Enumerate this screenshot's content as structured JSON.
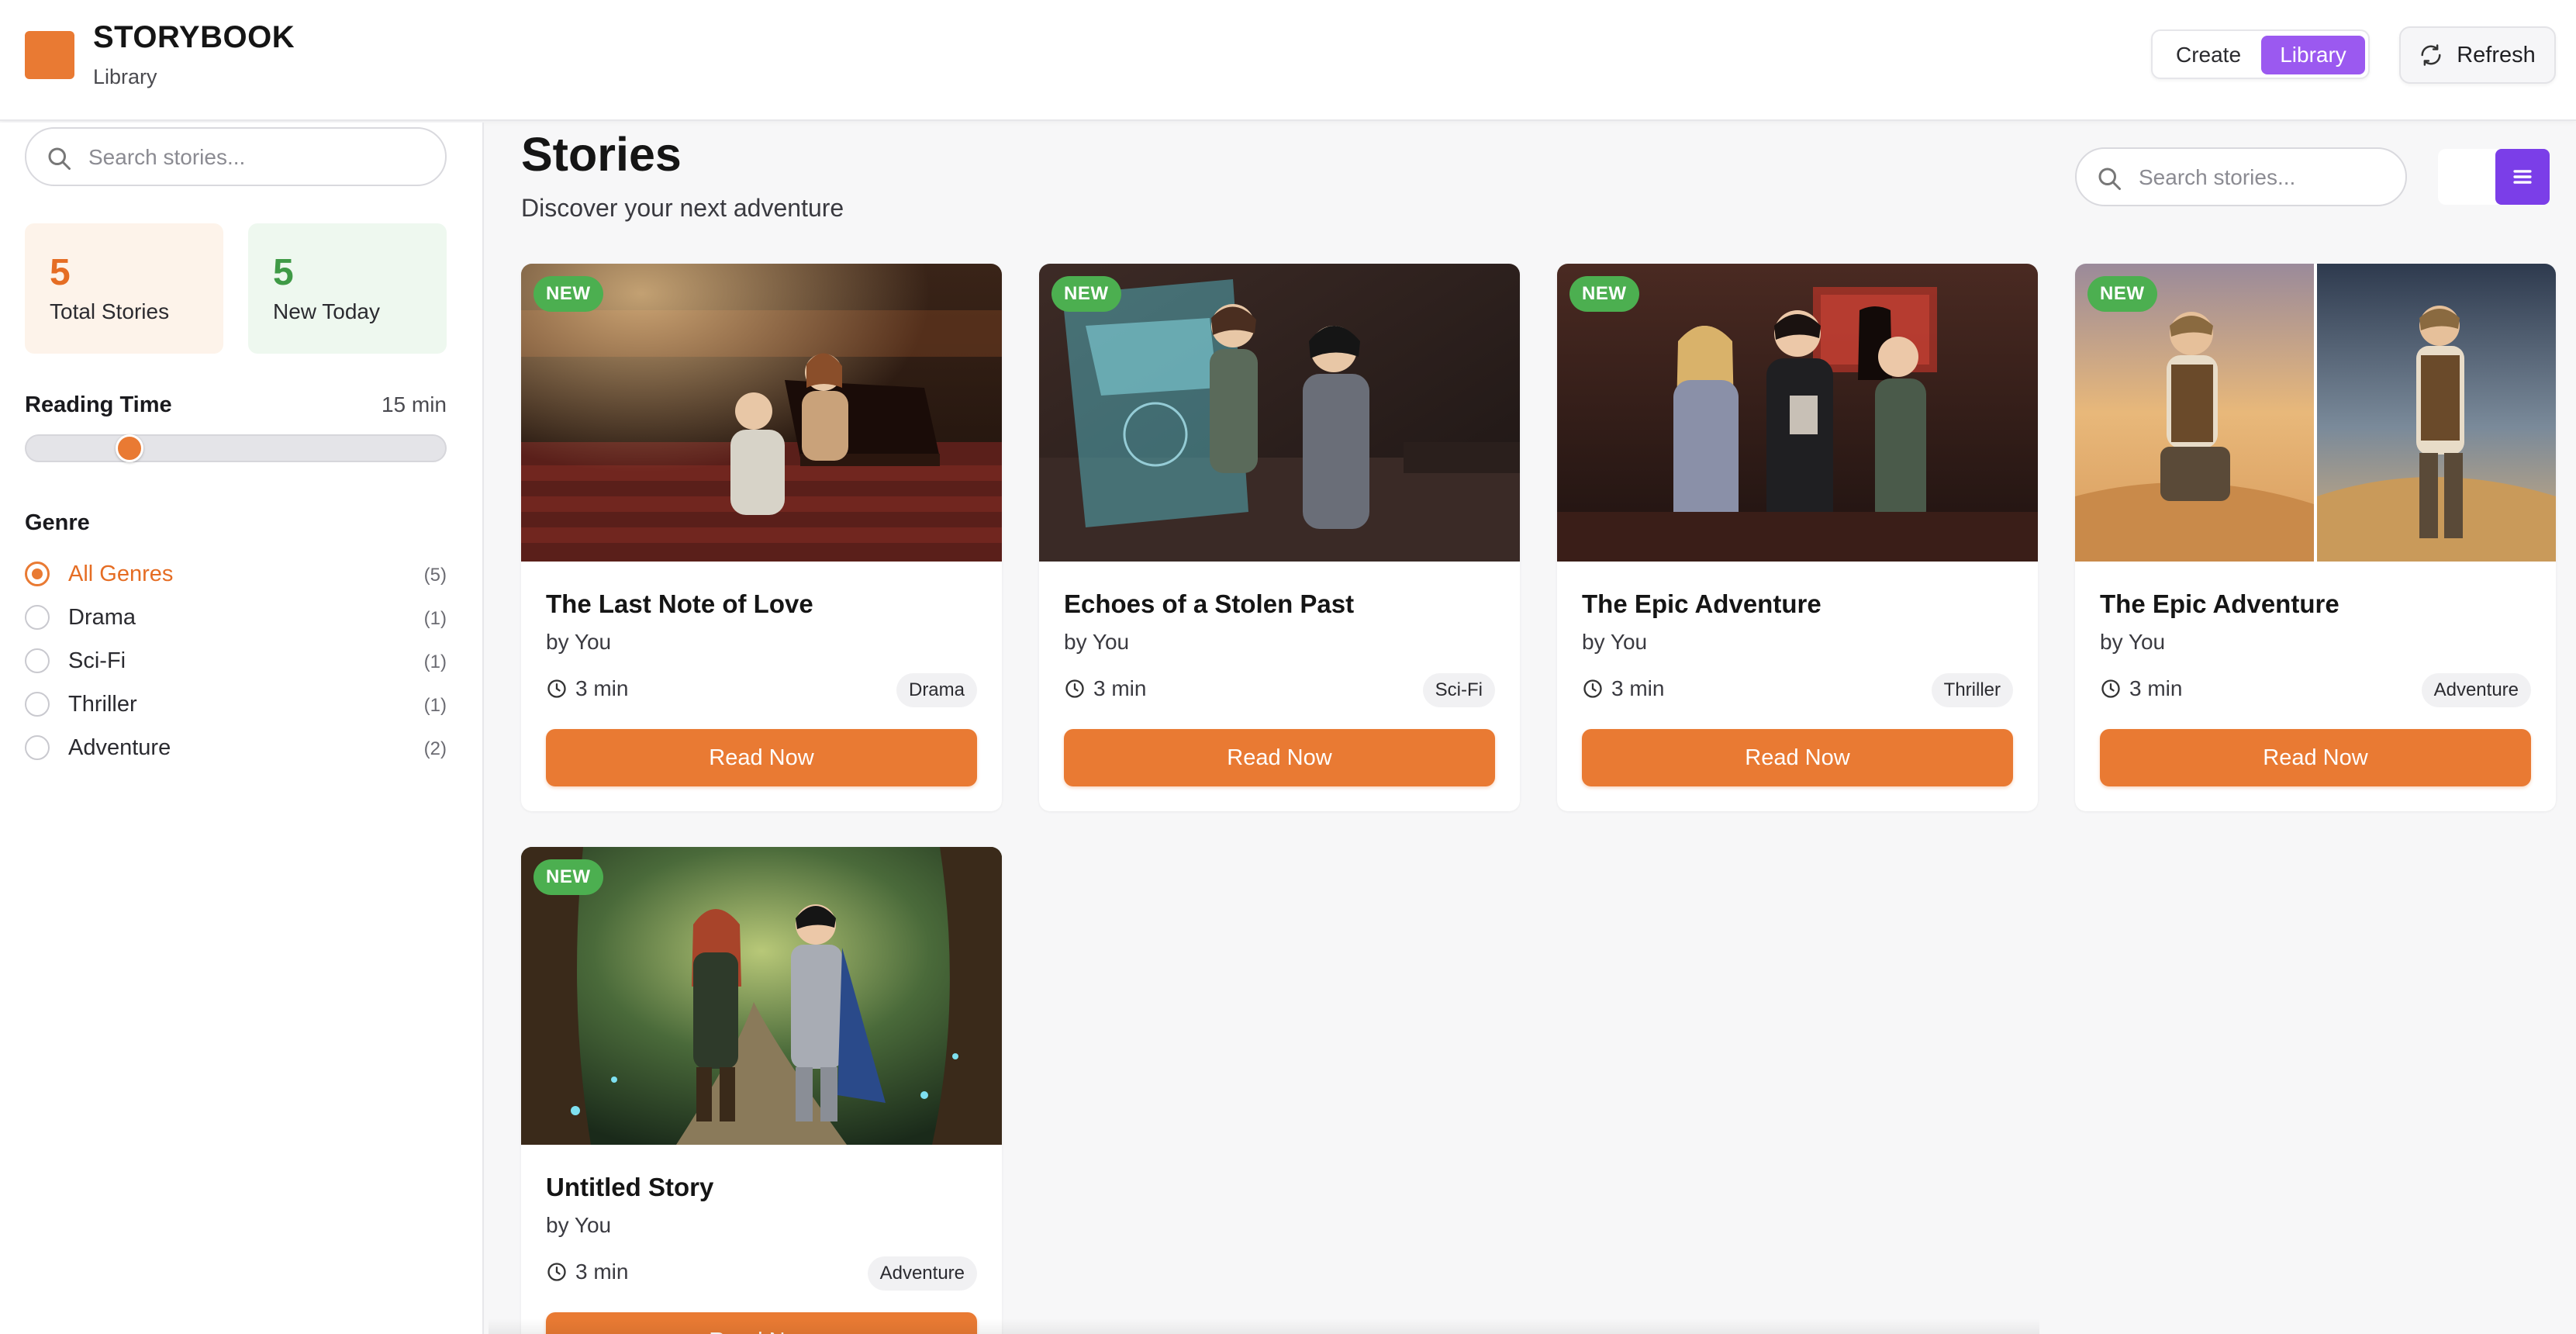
{
  "app": {
    "brand_title": "STORYBOOK",
    "brand_subtitle": "Library",
    "accent_color": "#e97a33",
    "mode_toggle": {
      "create_label": "Create",
      "library_label": "Library",
      "active": "Library"
    },
    "refresh_label": "Refresh"
  },
  "sidebar": {
    "search_placeholder": "Search stories...",
    "stats": [
      {
        "value": "5",
        "label": "Total Stories"
      },
      {
        "value": "5",
        "label": "New Today"
      }
    ],
    "reading_time": {
      "label": "Reading Time",
      "value": "15 min",
      "slider_fraction": 0.23
    },
    "genre_heading": "Genre",
    "genres": [
      {
        "name": "All Genres",
        "count": "(5)",
        "selected": true
      },
      {
        "name": "Drama",
        "count": "(1)",
        "selected": false
      },
      {
        "name": "Sci-Fi",
        "count": "(1)",
        "selected": false
      },
      {
        "name": "Thriller",
        "count": "(1)",
        "selected": false
      },
      {
        "name": "Adventure",
        "count": "(2)",
        "selected": false
      }
    ]
  },
  "main": {
    "title": "Stories",
    "subtitle": "Discover your next adventure",
    "search_placeholder": "Search stories...",
    "view_mode": "list",
    "cards": [
      {
        "badge": "NEW",
        "title": "The Last Note of Love",
        "author": "by You",
        "time": "3 min",
        "genre": "Drama",
        "cta": "Read Now"
      },
      {
        "badge": "NEW",
        "title": "Echoes of a Stolen Past",
        "author": "by You",
        "time": "3 min",
        "genre": "Sci-Fi",
        "cta": "Read Now"
      },
      {
        "badge": "NEW",
        "title": "The Epic Adventure",
        "author": "by You",
        "time": "3 min",
        "genre": "Thriller",
        "cta": "Read Now"
      },
      {
        "badge": "NEW",
        "title": "The Epic Adventure",
        "author": "by You",
        "time": "3 min",
        "genre": "Adventure",
        "cta": "Read Now"
      },
      {
        "badge": "NEW",
        "title": "Untitled Story",
        "author": "by You",
        "time": "3 min",
        "genre": "Adventure",
        "cta": "Read Now"
      }
    ]
  }
}
